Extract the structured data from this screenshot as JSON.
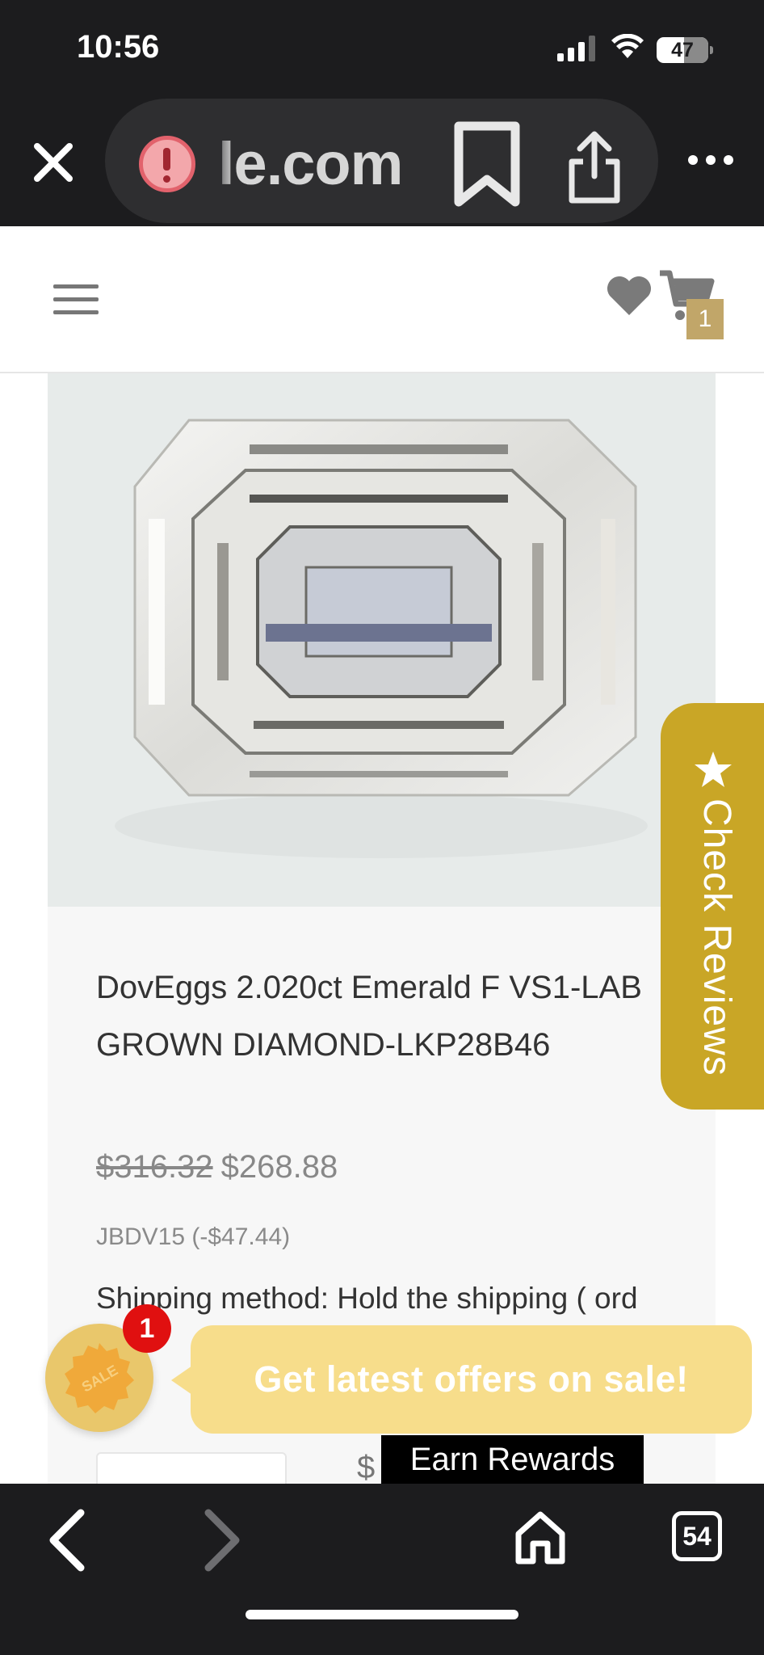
{
  "status_bar": {
    "time": "10:56",
    "battery": "47"
  },
  "browser": {
    "url": "le.com",
    "open_tabs": "54"
  },
  "header": {
    "cart_count": "1"
  },
  "product": {
    "title": "DovEggs 2.020ct Emerald F VS1-LAB GROWN DIAMOND-LKP28B46",
    "price_original": "$316.32",
    "price_sale": "$268.88",
    "coupon": "JBDV15 (-$47.44)",
    "shipping": "Shipping method: Hold the shipping ( ord eth",
    "partial_price": "$"
  },
  "reviews_tab": {
    "label": "Check Reviews"
  },
  "sale_popup": {
    "seal_text": "SALE",
    "badge_count": "1",
    "message": "Get latest offers on sale!"
  },
  "rewards": {
    "label": "Earn Rewards"
  },
  "colors": {
    "gold": "#c9a626",
    "sale_bubble": "#f7dd8b",
    "cart_badge": "#c1a669",
    "browser_chrome": "#1c1c1e"
  },
  "icons": [
    "close-icon",
    "warning-icon",
    "bookmark-icon",
    "share-icon",
    "more-icon",
    "menu-icon",
    "heart-icon",
    "cart-icon",
    "star-icon",
    "sale-seal-icon",
    "back-icon",
    "forward-icon",
    "home-icon",
    "tabs-icon"
  ]
}
